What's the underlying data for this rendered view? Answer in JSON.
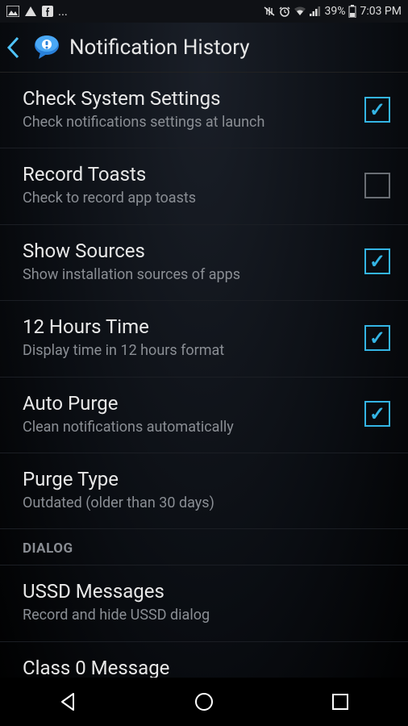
{
  "status": {
    "time": "7:03 PM",
    "battery": "39%",
    "ellipsis": "..."
  },
  "appbar": {
    "title": "Notification History"
  },
  "settings": [
    {
      "title": "Check System Settings",
      "subtitle": "Check notifications settings at launch",
      "checked": true,
      "hasCheckbox": true
    },
    {
      "title": "Record Toasts",
      "subtitle": "Check to record app toasts",
      "checked": false,
      "hasCheckbox": true
    },
    {
      "title": "Show Sources",
      "subtitle": "Show installation sources of apps",
      "checked": true,
      "hasCheckbox": true
    },
    {
      "title": "12 Hours Time",
      "subtitle": "Display time in 12 hours format",
      "checked": true,
      "hasCheckbox": true
    },
    {
      "title": "Auto Purge",
      "subtitle": "Clean notifications automatically",
      "checked": true,
      "hasCheckbox": true
    },
    {
      "title": "Purge Type",
      "subtitle": "Outdated (older than 30 days)",
      "hasCheckbox": false
    }
  ],
  "sectionHeader": "DIALOG",
  "dialogSettings": [
    {
      "title": "USSD Messages",
      "subtitle": "Record and hide USSD dialog",
      "hasCheckbox": false
    },
    {
      "title": "Class 0 Message",
      "subtitle": "",
      "hasCheckbox": false
    }
  ]
}
